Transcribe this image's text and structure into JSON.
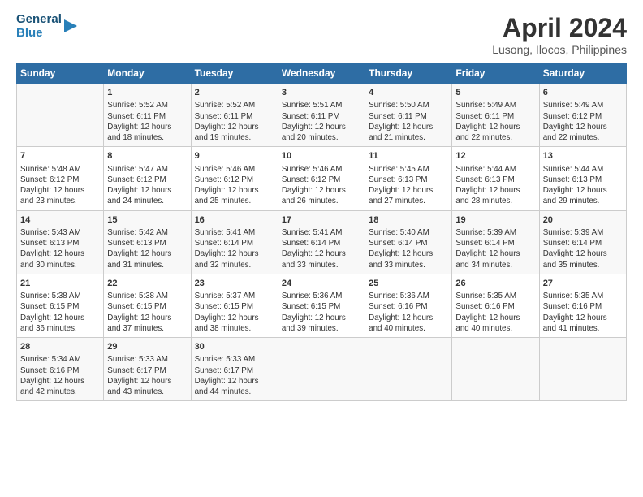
{
  "header": {
    "logo_line1": "General",
    "logo_line2": "Blue",
    "title": "April 2024",
    "subtitle": "Lusong, Ilocos, Philippines"
  },
  "columns": [
    "Sunday",
    "Monday",
    "Tuesday",
    "Wednesday",
    "Thursday",
    "Friday",
    "Saturday"
  ],
  "weeks": [
    [
      {
        "day": "",
        "info": ""
      },
      {
        "day": "1",
        "info": "Sunrise: 5:52 AM\nSunset: 6:11 PM\nDaylight: 12 hours\nand 18 minutes."
      },
      {
        "day": "2",
        "info": "Sunrise: 5:52 AM\nSunset: 6:11 PM\nDaylight: 12 hours\nand 19 minutes."
      },
      {
        "day": "3",
        "info": "Sunrise: 5:51 AM\nSunset: 6:11 PM\nDaylight: 12 hours\nand 20 minutes."
      },
      {
        "day": "4",
        "info": "Sunrise: 5:50 AM\nSunset: 6:11 PM\nDaylight: 12 hours\nand 21 minutes."
      },
      {
        "day": "5",
        "info": "Sunrise: 5:49 AM\nSunset: 6:11 PM\nDaylight: 12 hours\nand 22 minutes."
      },
      {
        "day": "6",
        "info": "Sunrise: 5:49 AM\nSunset: 6:12 PM\nDaylight: 12 hours\nand 22 minutes."
      }
    ],
    [
      {
        "day": "7",
        "info": "Sunrise: 5:48 AM\nSunset: 6:12 PM\nDaylight: 12 hours\nand 23 minutes."
      },
      {
        "day": "8",
        "info": "Sunrise: 5:47 AM\nSunset: 6:12 PM\nDaylight: 12 hours\nand 24 minutes."
      },
      {
        "day": "9",
        "info": "Sunrise: 5:46 AM\nSunset: 6:12 PM\nDaylight: 12 hours\nand 25 minutes."
      },
      {
        "day": "10",
        "info": "Sunrise: 5:46 AM\nSunset: 6:12 PM\nDaylight: 12 hours\nand 26 minutes."
      },
      {
        "day": "11",
        "info": "Sunrise: 5:45 AM\nSunset: 6:13 PM\nDaylight: 12 hours\nand 27 minutes."
      },
      {
        "day": "12",
        "info": "Sunrise: 5:44 AM\nSunset: 6:13 PM\nDaylight: 12 hours\nand 28 minutes."
      },
      {
        "day": "13",
        "info": "Sunrise: 5:44 AM\nSunset: 6:13 PM\nDaylight: 12 hours\nand 29 minutes."
      }
    ],
    [
      {
        "day": "14",
        "info": "Sunrise: 5:43 AM\nSunset: 6:13 PM\nDaylight: 12 hours\nand 30 minutes."
      },
      {
        "day": "15",
        "info": "Sunrise: 5:42 AM\nSunset: 6:13 PM\nDaylight: 12 hours\nand 31 minutes."
      },
      {
        "day": "16",
        "info": "Sunrise: 5:41 AM\nSunset: 6:14 PM\nDaylight: 12 hours\nand 32 minutes."
      },
      {
        "day": "17",
        "info": "Sunrise: 5:41 AM\nSunset: 6:14 PM\nDaylight: 12 hours\nand 33 minutes."
      },
      {
        "day": "18",
        "info": "Sunrise: 5:40 AM\nSunset: 6:14 PM\nDaylight: 12 hours\nand 33 minutes."
      },
      {
        "day": "19",
        "info": "Sunrise: 5:39 AM\nSunset: 6:14 PM\nDaylight: 12 hours\nand 34 minutes."
      },
      {
        "day": "20",
        "info": "Sunrise: 5:39 AM\nSunset: 6:14 PM\nDaylight: 12 hours\nand 35 minutes."
      }
    ],
    [
      {
        "day": "21",
        "info": "Sunrise: 5:38 AM\nSunset: 6:15 PM\nDaylight: 12 hours\nand 36 minutes."
      },
      {
        "day": "22",
        "info": "Sunrise: 5:38 AM\nSunset: 6:15 PM\nDaylight: 12 hours\nand 37 minutes."
      },
      {
        "day": "23",
        "info": "Sunrise: 5:37 AM\nSunset: 6:15 PM\nDaylight: 12 hours\nand 38 minutes."
      },
      {
        "day": "24",
        "info": "Sunrise: 5:36 AM\nSunset: 6:15 PM\nDaylight: 12 hours\nand 39 minutes."
      },
      {
        "day": "25",
        "info": "Sunrise: 5:36 AM\nSunset: 6:16 PM\nDaylight: 12 hours\nand 40 minutes."
      },
      {
        "day": "26",
        "info": "Sunrise: 5:35 AM\nSunset: 6:16 PM\nDaylight: 12 hours\nand 40 minutes."
      },
      {
        "day": "27",
        "info": "Sunrise: 5:35 AM\nSunset: 6:16 PM\nDaylight: 12 hours\nand 41 minutes."
      }
    ],
    [
      {
        "day": "28",
        "info": "Sunrise: 5:34 AM\nSunset: 6:16 PM\nDaylight: 12 hours\nand 42 minutes."
      },
      {
        "day": "29",
        "info": "Sunrise: 5:33 AM\nSunset: 6:17 PM\nDaylight: 12 hours\nand 43 minutes."
      },
      {
        "day": "30",
        "info": "Sunrise: 5:33 AM\nSunset: 6:17 PM\nDaylight: 12 hours\nand 44 minutes."
      },
      {
        "day": "",
        "info": ""
      },
      {
        "day": "",
        "info": ""
      },
      {
        "day": "",
        "info": ""
      },
      {
        "day": "",
        "info": ""
      }
    ]
  ]
}
